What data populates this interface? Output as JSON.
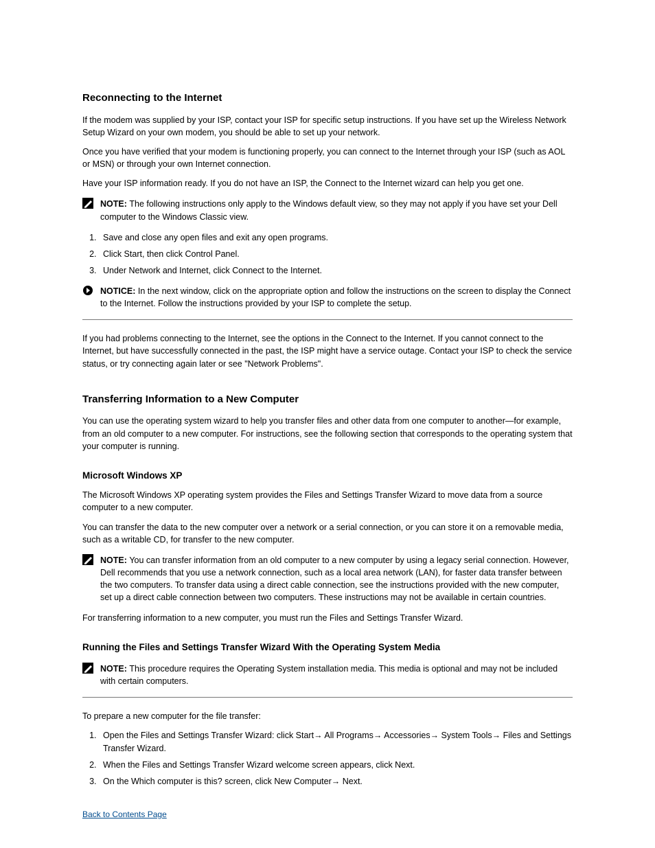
{
  "h_reconnecting": "Reconnecting to the Internet",
  "p_reconnecting_1": "If the modem was supplied by your ISP, contact your ISP for specific setup instructions. If you have set up the Wireless Network Setup Wizard on your own modem, you should be able to set up your network.",
  "p_reconnecting_2": "Once you have verified that your modem is functioning properly, you can connect to the Internet through your ISP (such as AOL or MSN) or through your own Internet connection.",
  "p_reconnecting_3": "Have your ISP information ready. If you do not have an ISP, the Connect to the Internet wizard can help you get one.",
  "note1_label": "NOTE: ",
  "note1_text": "The following instructions only apply to the Windows default view, so they may not apply if you have set your Dell computer to the Windows Classic view.",
  "steps1": [
    "Save and close any open files and exit any open programs.",
    "Click Start, then click Control Panel.",
    "Under Network and Internet, click Connect to the Internet."
  ],
  "notice_label": "NOTICE: ",
  "notice_text": "In the next window, click on the appropriate option and follow the instructions on the screen to display the Connect to the Internet. Follow the instructions provided by your ISP to complete the setup.",
  "p_reconnecting_4": "If you had problems connecting to the Internet, see the options in the Connect to the Internet. If you cannot connect to the Internet, but have successfully connected in the past, the ISP might have a service outage. Contact your ISP to check the service status, or try connecting again later or see \"Network Problems\".",
  "h_transfer": "Transferring Information to a New Computer",
  "p_transfer_1": "You can use the operating system wizard to help you transfer files and other data from one computer to another—for example, from an old computer to a new computer. For instructions, see the following section that corresponds to the operating system that your computer is running.",
  "h_xp": "Microsoft Windows XP",
  "p_xp_1": "The Microsoft Windows XP operating system provides the Files and Settings Transfer Wizard to move data from a source computer to a new computer.",
  "p_xp_2": "You can transfer the data to the new computer over a network or a serial connection, or you can store it on a removable media, such as a writable CD, for transfer to the new computer.",
  "note2_label": "NOTE: ",
  "note2_text": "You can transfer information from an old computer to a new computer by using a legacy serial connection. However, Dell recommends that you use a network connection, such as a local area network (LAN), for faster data transfer between the two computers. To transfer data using a direct cable connection, see the instructions provided with the new computer, set up a direct cable connection between two computers. These instructions may not be available in certain countries.",
  "p_xp_3": "For transferring information to a new computer, you must run the Files and Settings Transfer Wizard.",
  "h_running_wizard": "Running the Files and Settings Transfer Wizard With the Operating System Media",
  "note3_label": "NOTE: ",
  "note3_text": "This procedure requires the Operating System installation media. This media is optional and may not be included with certain computers.",
  "p_prepare": "To prepare a new computer for the file transfer:",
  "steps2": [
    "Open the Files and Settings Transfer Wizard: click Start→ All Programs→ Accessories→ System Tools→ Files and Settings Transfer Wizard.",
    "When the Files and Settings Transfer Wizard welcome screen appears, click Next.",
    "On the Which computer is this? screen, click New Computer→ Next."
  ],
  "back_link": "Back to Contents Page"
}
